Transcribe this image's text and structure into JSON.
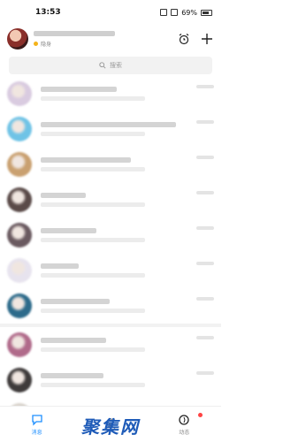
{
  "status_bar": {
    "time": "13:53",
    "battery": "69%"
  },
  "header": {
    "status_text": "隐身"
  },
  "search": {
    "placeholder": "搜索"
  },
  "conversations": [
    {
      "avatar_color": "#d9cbe0"
    },
    {
      "avatar_color": "#6fc3e6"
    },
    {
      "avatar_color": "#c9a070"
    },
    {
      "avatar_color": "#5a4a48"
    },
    {
      "avatar_color": "#6a5a60"
    },
    {
      "avatar_color": "#e7e3ee"
    },
    {
      "avatar_color": "#2c6a8a"
    },
    {
      "avatar_color": "#b06a8a"
    },
    {
      "avatar_color": "#3e3a3a"
    },
    {
      "avatar_color": "#d8d3cc"
    }
  ],
  "tabs": [
    {
      "label": "消息",
      "icon": "chat-bubble-icon",
      "active": true
    },
    {
      "label": "",
      "icon": "contacts-icon",
      "active": false
    },
    {
      "label": "动态",
      "icon": "star-icon",
      "active": false
    }
  ],
  "watermark": "聚集网",
  "colors": {
    "accent": "#1e8fff",
    "badge": "#ff4444"
  }
}
